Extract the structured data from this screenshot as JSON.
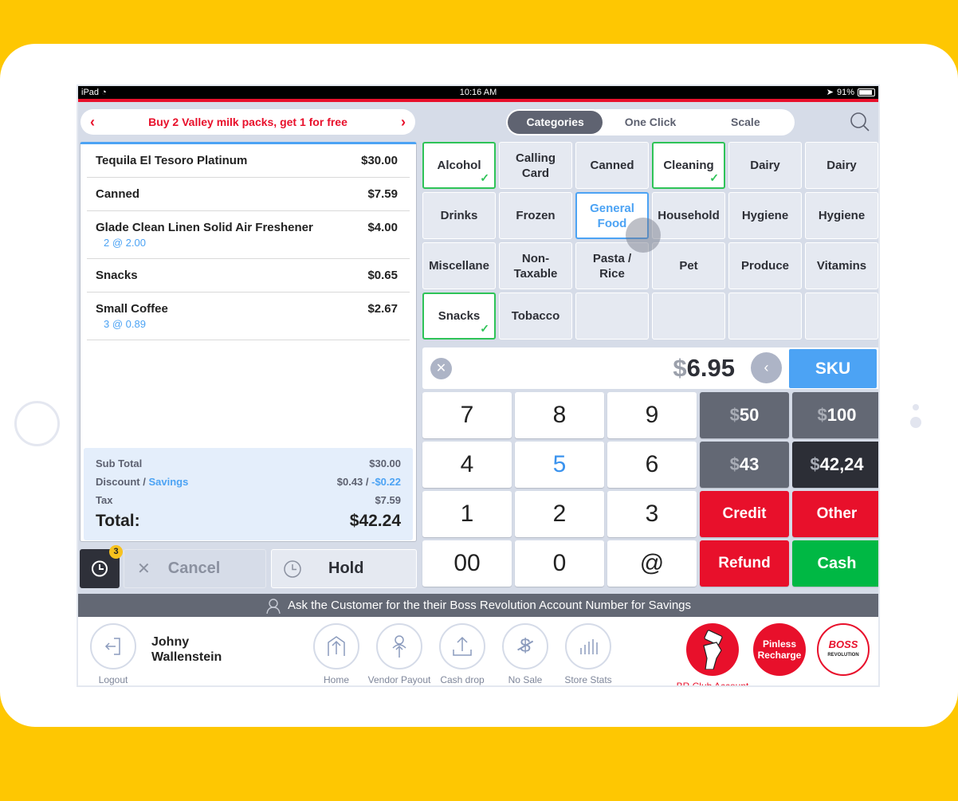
{
  "status_bar": {
    "device": "iPad",
    "time": "10:16 AM",
    "battery": "91%"
  },
  "promo": {
    "text": "Buy 2 Valley milk packs, get 1 for free"
  },
  "tabs": [
    {
      "label": "Categories",
      "active": true
    },
    {
      "label": "One Click",
      "active": false
    },
    {
      "label": "Scale",
      "active": false
    }
  ],
  "cart": {
    "items": [
      {
        "name": "Tequila El Tesoro Platinum",
        "price": "$30.00",
        "detail": ""
      },
      {
        "name": "Canned",
        "price": "$7.59",
        "detail": ""
      },
      {
        "name": "Glade Clean Linen Solid Air Freshener",
        "price": "$4.00",
        "detail": "2 @ 2.00"
      },
      {
        "name": "Snacks",
        "price": "$0.65",
        "detail": ""
      },
      {
        "name": "Small Coffee",
        "price": "$2.67",
        "detail": "3 @ 0.89"
      }
    ],
    "totals": {
      "subtotal_label": "Sub Total",
      "subtotal": "$30.00",
      "discount_label": "Discount / ",
      "savings_label": "Savings",
      "discount": "$0.43 / ",
      "savings": "-$0.22",
      "tax_label": "Tax",
      "tax": "$7.59",
      "total_label": "Total:",
      "total": "$42.24"
    }
  },
  "hold_bar": {
    "held_count": "3",
    "cancel_label": "Cancel",
    "hold_label": "Hold"
  },
  "categories": [
    {
      "label": "Alcohol",
      "state": "selected"
    },
    {
      "label": "Calling Card",
      "state": ""
    },
    {
      "label": "Canned",
      "state": ""
    },
    {
      "label": "Cleaning",
      "state": "selected"
    },
    {
      "label": "Dairy",
      "state": ""
    },
    {
      "label": "Dairy",
      "state": ""
    },
    {
      "label": "Drinks",
      "state": ""
    },
    {
      "label": "Frozen",
      "state": ""
    },
    {
      "label": "General Food",
      "state": "active"
    },
    {
      "label": "Household",
      "state": ""
    },
    {
      "label": "Hygiene",
      "state": ""
    },
    {
      "label": "Hygiene",
      "state": ""
    },
    {
      "label": "Miscellane",
      "state": ""
    },
    {
      "label": "Non-Taxable",
      "state": ""
    },
    {
      "label": "Pasta / Rice",
      "state": ""
    },
    {
      "label": "Pet",
      "state": ""
    },
    {
      "label": "Produce",
      "state": ""
    },
    {
      "label": "Vitamins",
      "state": ""
    },
    {
      "label": "Snacks",
      "state": "selected"
    },
    {
      "label": "Tobacco",
      "state": ""
    },
    {
      "label": "",
      "state": ""
    },
    {
      "label": "",
      "state": ""
    },
    {
      "label": "",
      "state": ""
    },
    {
      "label": "",
      "state": ""
    }
  ],
  "entry": {
    "currency": "$",
    "amount": "6.95",
    "sku_label": "SKU"
  },
  "keypad": [
    {
      "label": "7",
      "style": ""
    },
    {
      "label": "8",
      "style": ""
    },
    {
      "label": "9",
      "style": ""
    },
    {
      "label": "50",
      "style": "gray",
      "currency": "$"
    },
    {
      "label": "100",
      "style": "gray",
      "currency": "$"
    },
    {
      "label": "4",
      "style": ""
    },
    {
      "label": "5",
      "style": "blue"
    },
    {
      "label": "6",
      "style": ""
    },
    {
      "label": "43",
      "style": "gray",
      "currency": "$"
    },
    {
      "label": "42,24",
      "style": "dark",
      "currency": "$"
    },
    {
      "label": "1",
      "style": ""
    },
    {
      "label": "2",
      "style": ""
    },
    {
      "label": "3",
      "style": ""
    },
    {
      "label": "Credit",
      "style": "red"
    },
    {
      "label": "Other",
      "style": "red"
    },
    {
      "label": "00",
      "style": ""
    },
    {
      "label": "0",
      "style": ""
    },
    {
      "label": "@",
      "style": ""
    },
    {
      "label": "Refund",
      "style": "red"
    },
    {
      "label": "Cash",
      "style": "green"
    }
  ],
  "banner": {
    "text": "Ask the Customer for the their Boss Revolution Account Number for Savings"
  },
  "footer": {
    "logout_label": "Logout",
    "user_first": "Johny",
    "user_last": "Wallenstein",
    "actions": [
      {
        "label": "Home",
        "icon": "home-icon"
      },
      {
        "label": "Vendor Payout",
        "icon": "vendor-payout-icon"
      },
      {
        "label": "Cash drop",
        "icon": "cash-drop-icon"
      },
      {
        "label": "No Sale",
        "icon": "no-sale-icon"
      },
      {
        "label": "Store Stats",
        "icon": "store-stats-icon"
      }
    ],
    "br_club_label": "BR Club Account",
    "pinless_line1": "Pinless",
    "pinless_line2": "Recharge",
    "boss_line1": "BOSS",
    "boss_line2": "REVOLUTION"
  },
  "colors": {
    "brand_red": "#e8102b",
    "accent_blue": "#4ca3f4",
    "success_green": "#00b844",
    "frame_yellow": "#fec702"
  }
}
